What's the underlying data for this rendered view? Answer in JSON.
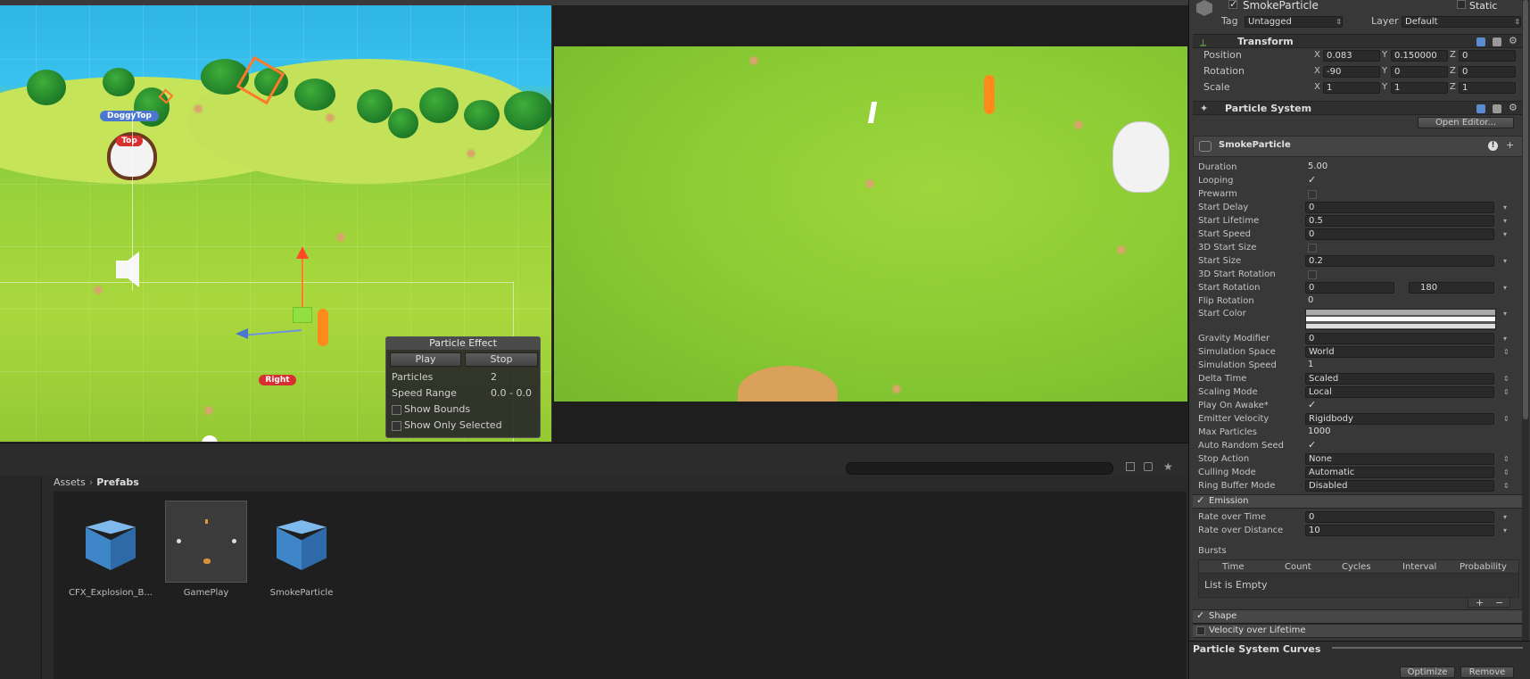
{
  "scene": {
    "labels": {
      "doggy_top": "DoggyTop",
      "top": "Top",
      "right": "Right"
    },
    "particle_effect": {
      "title": "Particle Effect",
      "play_label": "Play",
      "stop_label": "Stop",
      "particles_label": "Particles",
      "particles_value": "2",
      "speed_range_label": "Speed Range",
      "speed_range_value": "0.0 - 0.0",
      "show_bounds_label": "Show Bounds",
      "show_only_selected_label": "Show Only Selected"
    }
  },
  "project": {
    "breadcrumb": [
      "Assets",
      "Prefabs"
    ],
    "assets": [
      {
        "name": "CFX_Explosion_B...",
        "icon": "prefab-cube-icon"
      },
      {
        "name": "GamePlay",
        "icon": "scene-thumbnail"
      },
      {
        "name": "SmokeParticle",
        "icon": "prefab-cube-icon"
      }
    ]
  },
  "inspector": {
    "object_name": "SmokeParticle",
    "static_label": "Static",
    "tag_label": "Tag",
    "tag_value": "Untagged",
    "layer_label": "Layer",
    "layer_value": "Default",
    "transform": {
      "title": "Transform",
      "position_label": "Position",
      "position": [
        "0.083",
        "0.150000",
        "0"
      ],
      "rotation_label": "Rotation",
      "rotation": [
        "-90",
        "0",
        "0"
      ],
      "scale_label": "Scale",
      "scale": [
        "1",
        "1",
        "1"
      ],
      "axis_labels": [
        "X",
        "Y",
        "Z"
      ]
    },
    "particle_system": {
      "title": "Particle System",
      "open_editor_label": "Open Editor...",
      "module_name": "SmokeParticle",
      "rows": [
        {
          "label": "Duration",
          "value": "5.00",
          "kind": "field"
        },
        {
          "label": "Looping",
          "value": "",
          "kind": "check-on"
        },
        {
          "label": "Prewarm",
          "value": "",
          "kind": "check-off"
        },
        {
          "label": "Start Delay",
          "value": "0",
          "kind": "dropdown-field"
        },
        {
          "label": "Start Lifetime",
          "value": "0.5",
          "kind": "dropdown-field"
        },
        {
          "label": "Start Speed",
          "value": "0",
          "kind": "dropdown-field"
        },
        {
          "label": "3D Start Size",
          "value": "",
          "kind": "check-off"
        },
        {
          "label": "Start Size",
          "value": "0.2",
          "kind": "dropdown-field"
        },
        {
          "label": "3D Start Rotation",
          "value": "",
          "kind": "check-off"
        },
        {
          "label": "Start Rotation",
          "value": "0",
          "value2": "180",
          "kind": "dual-field"
        },
        {
          "label": "Flip Rotation",
          "value": "0",
          "kind": "field"
        },
        {
          "label": "Start Color",
          "value": "",
          "kind": "gradient"
        },
        {
          "label": "Gravity Modifier",
          "value": "0",
          "kind": "dropdown-field"
        },
        {
          "label": "Simulation Space",
          "value": "World",
          "kind": "dropdown"
        },
        {
          "label": "Simulation Speed",
          "value": "1",
          "kind": "field"
        },
        {
          "label": "Delta Time",
          "value": "Scaled",
          "kind": "dropdown"
        },
        {
          "label": "Scaling Mode",
          "value": "Local",
          "kind": "dropdown"
        },
        {
          "label": "Play On Awake*",
          "value": "",
          "kind": "check-on"
        },
        {
          "label": "Emitter Velocity",
          "value": "Rigidbody",
          "kind": "dropdown"
        },
        {
          "label": "Max Particles",
          "value": "1000",
          "kind": "field"
        },
        {
          "label": "Auto Random Seed",
          "value": "",
          "kind": "check-on"
        },
        {
          "label": "Stop Action",
          "value": "None",
          "kind": "dropdown"
        },
        {
          "label": "Culling Mode",
          "value": "Automatic",
          "kind": "dropdown"
        },
        {
          "label": "Ring Buffer Mode",
          "value": "Disabled",
          "kind": "dropdown"
        }
      ],
      "emission": {
        "title": "Emission",
        "rate_over_time_label": "Rate over Time",
        "rate_over_time": "0",
        "rate_over_distance_label": "Rate over Distance",
        "rate_over_distance": "10",
        "bursts_label": "Bursts",
        "burst_columns": [
          "Time",
          "Count",
          "Cycles",
          "Interval",
          "Probability"
        ],
        "burst_empty": "List is Empty",
        "add_label": "+",
        "remove_label": "−"
      },
      "shape_label": "Shape",
      "velocity_label": "Velocity over Lifetime"
    },
    "curves_title": "Particle System Curves",
    "optimize_label": "Optimize",
    "remove_label": "Remove"
  }
}
